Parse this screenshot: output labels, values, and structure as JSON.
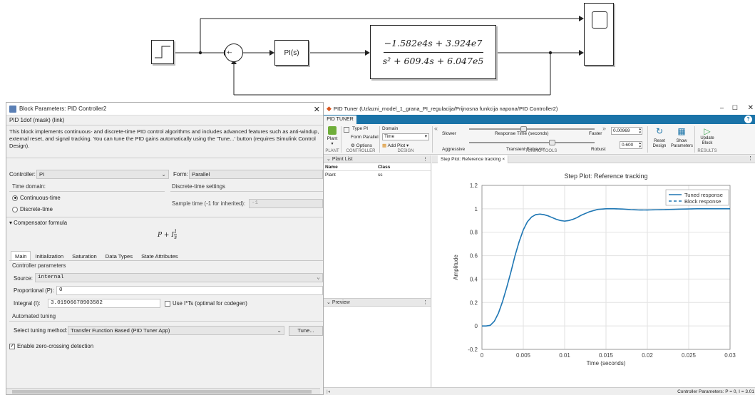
{
  "diagram": {
    "pid_block_label": "PI(s)",
    "sum_signs": "+-",
    "tf_numerator": "−1.582e4s + 3.924e7",
    "tf_denominator": "s² + 609.4s + 6.047e5"
  },
  "block_params": {
    "title": "Block Parameters: PID Controller2",
    "subtitle": "PID 1dof (mask) (link)",
    "description": "This block implements continuous- and discrete-time PID control algorithms and includes advanced features such as anti-windup, external reset, and signal tracking. You can tune the PID gains automatically using the 'Tune...' button (requires Simulink Control Design).",
    "controller_label": "Controller:",
    "controller_value": "PI",
    "form_label": "Form:",
    "form_value": "Parallel",
    "time_domain_label": "Time domain:",
    "continuous_label": "Continuous-time",
    "discrete_label": "Discrete-time",
    "discrete_settings_label": "Discrete-time settings",
    "sample_time_label": "Sample time (-1 for inherited):",
    "sample_time_value": "-1",
    "compensator_label": "Compensator formula",
    "tabs": [
      "Main",
      "Initialization",
      "Saturation",
      "Data Types",
      "State Attributes"
    ],
    "controller_params_label": "Controller parameters",
    "source_label": "Source:",
    "source_value": "internal",
    "proportional_label": "Proportional (P):",
    "proportional_value": "0",
    "integral_label": "Integral (I):",
    "integral_value": "3.01906678903582",
    "use_its_label": "Use I*Ts (optimal for codegen)",
    "auto_tuning_label": "Automated tuning",
    "tuning_method_label": "Select tuning method:",
    "tuning_method_value": "Transfer Function Based (PID Tuner App)",
    "tune_button": "Tune...",
    "zero_crossing_label": "Enable zero-crossing detection"
  },
  "pid_tuner": {
    "title": "PID Tuner (Uzlazni_model_1_grana_PI_regulacija/Prijnosna funkcija napona/PID Controller2)",
    "tab_label": "PID TUNER",
    "plant_label": "Plant",
    "group_plant": "PLANT",
    "type_label": "Type PI",
    "form_label": "Form Parallel",
    "options_label": "Options",
    "group_controller": "CONTROLLER",
    "domain_label": "Domain",
    "domain_value": "Time",
    "add_plot_label": "Add Plot",
    "group_design": "DESIGN",
    "slower_label": "Slower",
    "response_time_label": "Response Time (seconds)",
    "faster_label": "Faster",
    "response_time_value": "0.00969",
    "aggressive_label": "Aggressive",
    "transient_label": "Transient Behavior",
    "robust_label": "Robust",
    "transient_value": "0.600",
    "group_tuning_tools": "TUNING TOOLS",
    "reset_design_label": "Reset Design",
    "show_params_label": "Show Parameters",
    "update_block_label": "Update Block",
    "group_results": "RESULTS",
    "plant_list_title": "Plant List",
    "col_name": "Name",
    "col_class": "Class",
    "plant_row_name": "Plant",
    "plant_row_class": "ss",
    "preview_title": "Preview",
    "plot_tab_label": "Step Plot: Reference tracking",
    "status_text": "Controller Parameters: P = 0, I = 3.01"
  },
  "chart_data": {
    "type": "line",
    "title": "Step Plot: Reference tracking",
    "xlabel": "Time (seconds)",
    "ylabel": "Amplitude",
    "xlim": [
      0,
      0.03
    ],
    "ylim": [
      -0.2,
      1.2
    ],
    "xticks": [
      "0",
      "0.005",
      "0.01",
      "0.015",
      "0.02",
      "0.025",
      "0.03"
    ],
    "yticks": [
      "-0.2",
      "0",
      "0.2",
      "0.4",
      "0.6",
      "0.8",
      "1",
      "1.2"
    ],
    "grid": true,
    "legend_position": "top-right",
    "series": [
      {
        "name": "Tuned response",
        "style": "solid",
        "color": "#1f77b4",
        "x": [
          0,
          0.0005,
          0.001,
          0.0015,
          0.002,
          0.0025,
          0.003,
          0.0035,
          0.004,
          0.0045,
          0.005,
          0.0055,
          0.006,
          0.0065,
          0.007,
          0.0075,
          0.008,
          0.0085,
          0.009,
          0.0095,
          0.01,
          0.0105,
          0.011,
          0.0115,
          0.012,
          0.0125,
          0.013,
          0.014,
          0.015,
          0.016,
          0.017,
          0.018,
          0.019,
          0.02,
          0.022,
          0.024,
          0.026,
          0.028,
          0.03
        ],
        "y": [
          0,
          0.0,
          0.005,
          0.04,
          0.11,
          0.21,
          0.33,
          0.46,
          0.6,
          0.72,
          0.82,
          0.89,
          0.93,
          0.95,
          0.955,
          0.95,
          0.94,
          0.925,
          0.91,
          0.9,
          0.895,
          0.9,
          0.91,
          0.925,
          0.945,
          0.96,
          0.975,
          0.995,
          1.0,
          1.0,
          0.998,
          0.993,
          0.99,
          0.99,
          0.993,
          0.997,
          1.0,
          1.0,
          1.0
        ]
      },
      {
        "name": "Block response",
        "style": "dashed",
        "color": "#1f77b4",
        "x": [
          0,
          0.0005,
          0.001,
          0.0015,
          0.002,
          0.0025,
          0.003,
          0.0035,
          0.004,
          0.0045,
          0.005,
          0.0055,
          0.006,
          0.0065,
          0.007,
          0.0075,
          0.008,
          0.0085,
          0.009,
          0.0095,
          0.01,
          0.0105,
          0.011,
          0.0115,
          0.012,
          0.0125,
          0.013,
          0.014,
          0.015,
          0.016,
          0.017,
          0.018,
          0.019,
          0.02,
          0.022,
          0.024,
          0.026,
          0.028,
          0.03
        ],
        "y": [
          0,
          0.0,
          0.005,
          0.04,
          0.11,
          0.21,
          0.33,
          0.46,
          0.6,
          0.72,
          0.82,
          0.89,
          0.93,
          0.95,
          0.955,
          0.95,
          0.94,
          0.925,
          0.91,
          0.9,
          0.895,
          0.9,
          0.91,
          0.925,
          0.945,
          0.96,
          0.975,
          0.995,
          1.0,
          1.0,
          0.998,
          0.993,
          0.99,
          0.99,
          0.993,
          0.997,
          1.0,
          1.0,
          1.0
        ]
      }
    ]
  }
}
